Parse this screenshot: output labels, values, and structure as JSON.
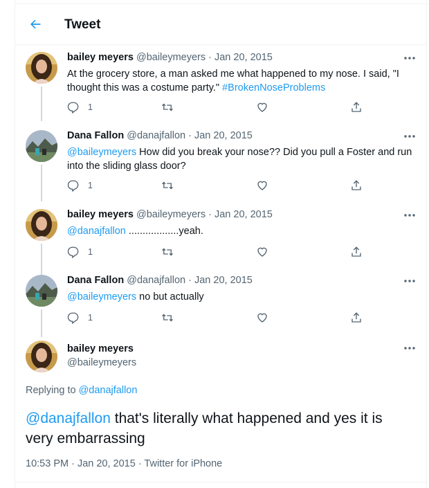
{
  "header": {
    "title": "Tweet",
    "back_icon": "arrow-left-icon"
  },
  "colors": {
    "accent": "#1d9bf0",
    "text": "#0f1419",
    "muted": "#536471",
    "border": "#eff3f4"
  },
  "thread": [
    {
      "name": "bailey meyers",
      "handle": "@baileymeyers",
      "date": "· Jan 20, 2015",
      "text_plain": "At the grocery store, a man asked me what happened to my nose. I said, \"I thought this was a costume party.\" ",
      "hashtag": "#BrokenNoseProblems",
      "replies": "1",
      "avatar": "bailey-avatar"
    },
    {
      "name": "Dana Fallon",
      "handle": "@danajfallon",
      "date": "· Jan 20, 2015",
      "mention": "@baileymeyers",
      "text_plain": " How did you break your nose?? Did you pull a Foster and run into the sliding glass door?",
      "replies": "1",
      "avatar": "dana-avatar"
    },
    {
      "name": "bailey meyers",
      "handle": "@baileymeyers",
      "date": "· Jan 20, 2015",
      "mention": "@danajfallon",
      "text_plain": " ..................yeah.",
      "replies": "1",
      "avatar": "bailey-avatar"
    },
    {
      "name": "Dana Fallon",
      "handle": "@danajfallon",
      "date": "· Jan 20, 2015",
      "mention": "@baileymeyers",
      "text_plain": " no but actually",
      "replies": "1",
      "avatar": "dana-avatar"
    }
  ],
  "main_tweet": {
    "name": "bailey meyers",
    "handle": "@baileymeyers",
    "replying_prefix": "Replying to ",
    "replying_to": "@danajfallon",
    "mention": "@danajfallon",
    "text_plain": " that's literally what happened and yes it is very embarrassing",
    "timestamp": "10:53 PM · Jan 20, 2015 · Twitter for iPhone"
  }
}
